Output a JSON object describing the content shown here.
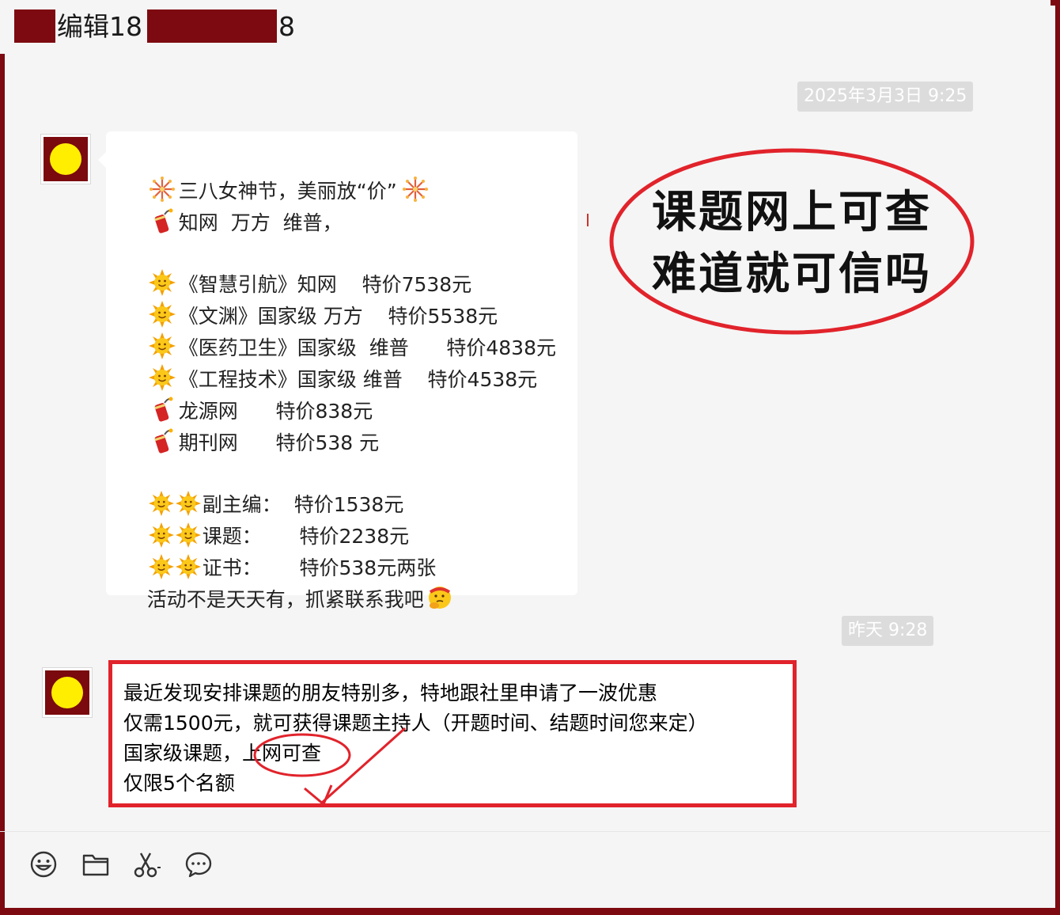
{
  "header": {
    "title_prefix": "编辑18",
    "title_suffix": "8"
  },
  "timestamps": {
    "first": "2025年3月3日 9:25",
    "second": "昨天 9:28"
  },
  "message1": {
    "lines": [
      {
        "icon": "fireworks-icon",
        "text": "三八女神节，美丽放“价”",
        "trail_icon": "fireworks-icon"
      },
      {
        "icon": "firecracker-icon",
        "text": "知网  万方  维普，"
      },
      {
        "icon": "",
        "text": ""
      },
      {
        "icon": "sun-icon",
        "text": "《智慧引航》知网    特价7538元"
      },
      {
        "icon": "sun-icon",
        "text": "《文渊》国家级 万方    特价5538元"
      },
      {
        "icon": "sun-icon",
        "text": "《医药卫生》国家级  维普      特价4838元"
      },
      {
        "icon": "sun-icon",
        "text": "《工程技术》国家级 维普    特价4538元"
      },
      {
        "icon": "firecracker-icon",
        "text": "龙源网      特价838元"
      },
      {
        "icon": "firecracker-icon",
        "text": "期刊网      特价538 元"
      },
      {
        "icon": "",
        "text": ""
      },
      {
        "icon": "sun-icon-double",
        "text": "副主编：  特价1538元"
      },
      {
        "icon": "sun-icon-double",
        "text": "课题：      特价2238元"
      },
      {
        "icon": "sun-icon-double",
        "text": "证书：      特价538元两张"
      },
      {
        "icon": "",
        "text": "活动不是天天有，抓紧联系我吧",
        "trail_icon": "thinking-face-icon"
      }
    ]
  },
  "message2": {
    "lines": [
      "最近发现安排课题的朋友特别多，特地跟社里申请了一波优惠",
      "仅需1500元，就可获得课题主持人（开题时间、结题时间您来定）",
      "国家级课题，上网可查",
      "仅限5个名额"
    ]
  },
  "callout": {
    "line1": "课题网上可查",
    "line2": "难道就可信吗"
  },
  "toolbar": {
    "icons": [
      "emoji-icon",
      "folder-icon",
      "scissors-icon",
      "chat-bubble-icon"
    ]
  },
  "colors": {
    "annotation_red": "#e1232b",
    "redaction": "#7d0a10",
    "avatar_bg": "#7a0a0e",
    "avatar_dot": "#ffee00"
  }
}
